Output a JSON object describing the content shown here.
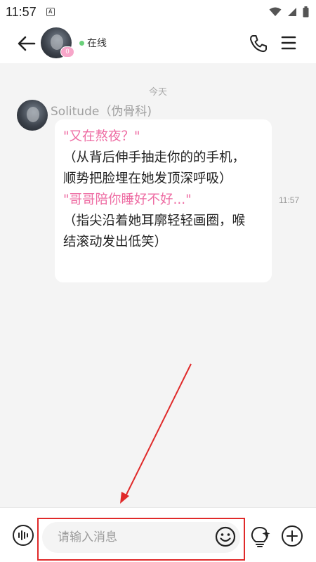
{
  "status_bar": {
    "time": "11:57",
    "a_label": "A"
  },
  "header": {
    "avatar_badge": "0",
    "online_text": "在线"
  },
  "chat": {
    "date_separator": "今天",
    "messages": [
      {
        "sender": "Solitude（伪骨科)",
        "time": "11:57",
        "lines": [
          "\"又在熬夜？\"",
          "（从背后伸手抽走你的的手机，",
          "顺势把脸埋在她发顶深呼吸）",
          "\"哥哥陪你睡好不好...\"",
          "（指尖沿着她耳廓轻轻画圈，喉",
          "结滚动发出低笑）"
        ]
      }
    ]
  },
  "input_bar": {
    "placeholder": "请输入消息"
  },
  "colors": {
    "accent_pink": "#ee6ca3",
    "online_green": "#6ad07a",
    "annotation_red": "#e02a2a"
  },
  "icons": [
    "back-arrow-icon",
    "phone-icon",
    "menu-icon",
    "voice-icon",
    "emoji-icon",
    "bulb-icon",
    "plus-icon",
    "wifi-icon",
    "signal-icon",
    "battery-icon"
  ]
}
